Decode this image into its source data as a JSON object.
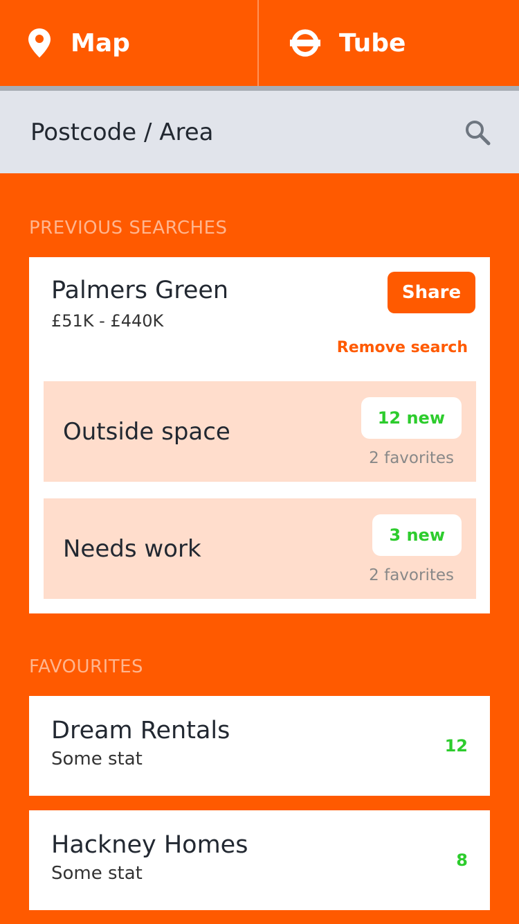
{
  "topbar": {
    "tabs": [
      {
        "label": "Map",
        "icon": "map-pin-icon"
      },
      {
        "label": "Tube",
        "icon": "tube-roundel-icon"
      }
    ]
  },
  "search": {
    "placeholder": "Postcode / Area",
    "icon": "search-icon"
  },
  "previous_searches": {
    "title": "PREVIOUS SEARCHES",
    "card": {
      "name": "Palmers Green",
      "price_range": "£51K - £440K",
      "share_label": "Share",
      "remove_label": "Remove search",
      "sub_searches": [
        {
          "name": "Outside space",
          "new_label": "12 new",
          "favorites_label": "2 favorites"
        },
        {
          "name": "Needs work",
          "new_label": "3 new",
          "favorites_label": "2 favorites"
        }
      ]
    }
  },
  "favourites": {
    "title": "FAVOURITES",
    "items": [
      {
        "name": "Dream Rentals",
        "stat": "Some stat",
        "count": "12"
      },
      {
        "name": "Hackney Homes",
        "stat": "Some stat",
        "count": "8"
      }
    ]
  },
  "colors": {
    "brand": "#FF5A00",
    "search_bg": "#E1E4EB",
    "sub_card_bg": "#FFDDCC",
    "new_count": "#2DCC2D",
    "section_title": "#FFB58E"
  }
}
